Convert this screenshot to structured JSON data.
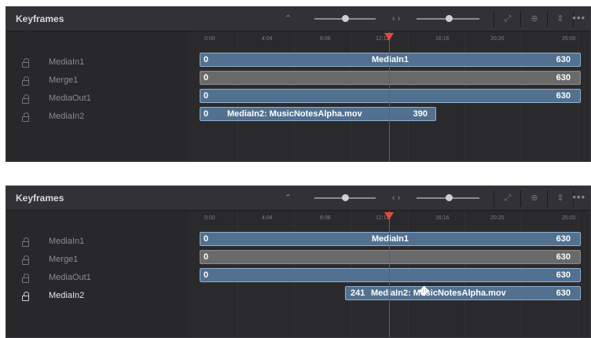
{
  "panels": [
    {
      "title": "Keyframes",
      "ruler": [
        "0:00",
        "4:04",
        "8:08",
        "12:12",
        "16:16",
        "20:20",
        "25:00"
      ],
      "tracks": [
        {
          "name": "MediaIn1",
          "active": false
        },
        {
          "name": "Merge1",
          "active": false
        },
        {
          "name": "MediaOut1",
          "active": false
        },
        {
          "name": "MediaIn2",
          "active": false
        }
      ],
      "bars": [
        {
          "start": "0",
          "mid": "MediaIn1",
          "end": "630"
        },
        {
          "start": "0",
          "mid": "",
          "end": "630"
        },
        {
          "start": "0",
          "mid": "",
          "end": "630"
        },
        {
          "start": "0",
          "mid": "MediaIn2: MusicNotesAlpha.mov",
          "end": "390"
        }
      ]
    },
    {
      "title": "Keyframes",
      "ruler": [
        "0:00",
        "4:04",
        "8:08",
        "12:12",
        "16:16",
        "20:20",
        "25:00"
      ],
      "tracks": [
        {
          "name": "MediaIn1",
          "active": false
        },
        {
          "name": "Merge1",
          "active": false
        },
        {
          "name": "MediaOut1",
          "active": false
        },
        {
          "name": "MediaIn2",
          "active": true
        }
      ],
      "bars": [
        {
          "start": "0",
          "mid": "MediaIn1",
          "end": "630"
        },
        {
          "start": "0",
          "mid": "",
          "end": "630"
        },
        {
          "start": "0",
          "mid": "",
          "end": "630"
        },
        {
          "start": "241",
          "mid": "MediaIn2: MusicNotesAlpha.mov",
          "end": "630"
        }
      ]
    }
  ],
  "toolbar": {
    "updown_icon": "up-down-arrows-icon",
    "arrows_icon": "left-right-arrows-icon",
    "fit_icon": "fit-icon",
    "zoom_icon": "zoom-icon",
    "sort_icon": "sort-icon",
    "more_label": "•••"
  },
  "colors": {
    "bar": "#52708f",
    "bar_border": "#8fb0cd",
    "merge_bar": "#6a6a6b",
    "playhead": "#e04a3a"
  }
}
